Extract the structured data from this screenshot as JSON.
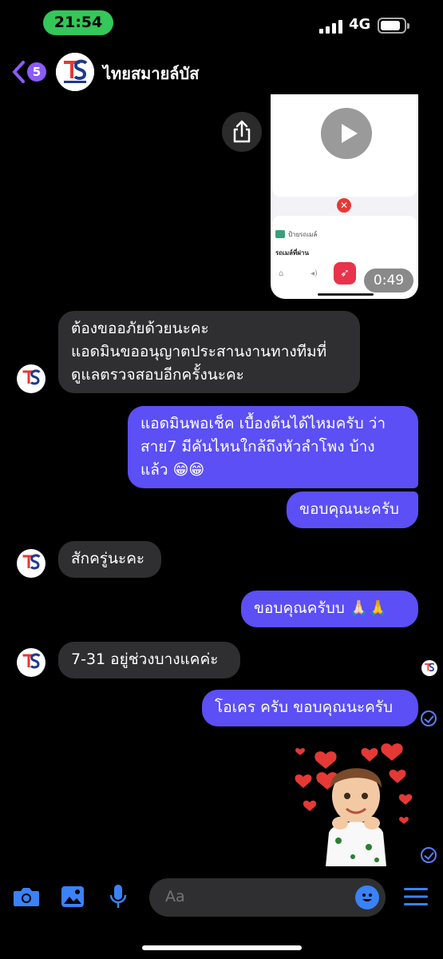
{
  "status_bar": {
    "time": "21:54",
    "network": "4G",
    "battery_level": 0.85
  },
  "header": {
    "unread_count": "5",
    "title": "ไทยสมายล์บัส"
  },
  "shared_media": {
    "app_name": "ป้ายรถเมล์",
    "subtitle": "รถเมล์ที่ผ่าน",
    "duration": "0:49"
  },
  "messages": [
    {
      "id": "m1",
      "direction": "in",
      "text": "ต้องขออภัยด้วยนะคะ\nแอดมินขออนุญาตประสานงานทางทีมที่\nดูแลตรวจสอบอีกครั้งนะคะ"
    },
    {
      "id": "m2",
      "direction": "out",
      "text": "แอดมินพอเช็ค เบื้องต้นได้ไหมครับ ว่า\nสาย7 มีคันไหนใกล้ถึงหัวลำโพง บ้าง\nแล้ว 😁😁"
    },
    {
      "id": "m3",
      "direction": "out",
      "text": "ขอบคุณนะครับ"
    },
    {
      "id": "m4",
      "direction": "in",
      "text": "สักครู่นะคะ"
    },
    {
      "id": "m5",
      "direction": "out",
      "text": "ขอบคุณครับบ 🙏🏻🙏"
    },
    {
      "id": "m6",
      "direction": "in",
      "text": "7-31 อยู่ช่วงบางแคค่ะ"
    },
    {
      "id": "m7",
      "direction": "out",
      "text": "โอเคร ครับ ขอบคุณนะครับ"
    }
  ],
  "composer": {
    "placeholder": "Aa"
  },
  "colors": {
    "outgoing_bubble": "#5b4ff5",
    "incoming_bubble": "#2f2f31",
    "accent": "#3b82f6",
    "status_pill": "#34c759"
  },
  "icons": [
    "back-chevron-icon",
    "share-icon",
    "play-icon",
    "camera-icon",
    "image-icon",
    "microphone-icon",
    "emoji-icon",
    "menu-icon",
    "seen-check-icon"
  ]
}
